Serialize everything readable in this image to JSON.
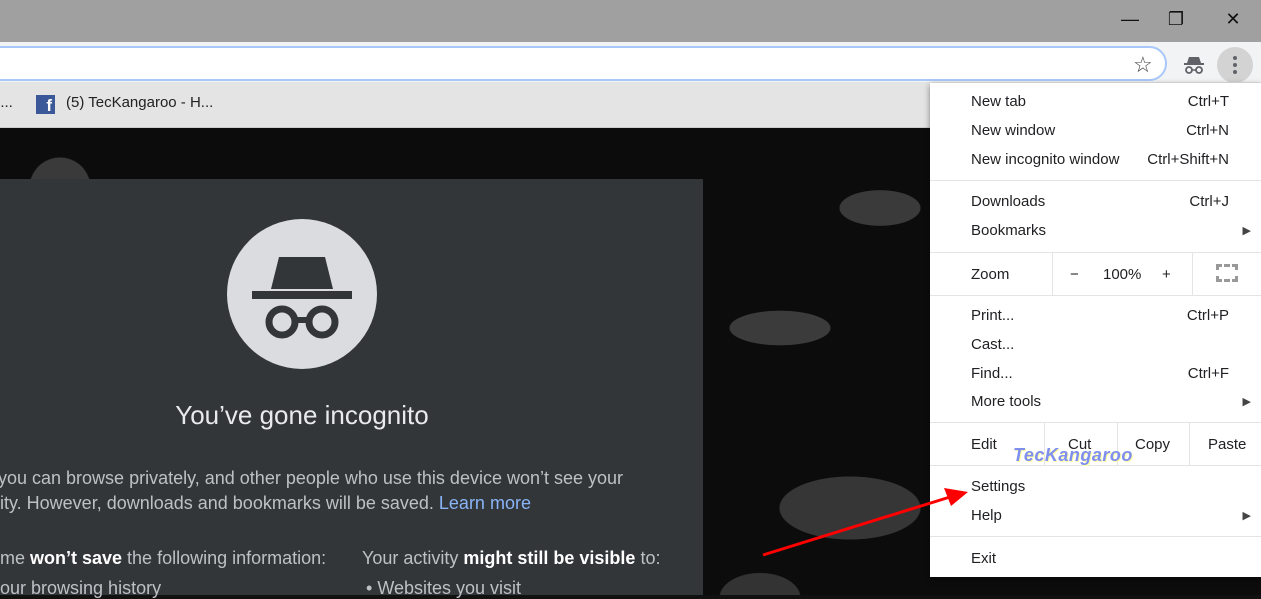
{
  "window": {
    "minimize": "—",
    "restore": "❐",
    "close": "✕"
  },
  "toolbar": {
    "star": "☆"
  },
  "bookmarks": [
    {
      "label": "o..."
    },
    {
      "label": "(5) TecKangaroo - H..."
    }
  ],
  "incognito": {
    "title": "You’ve gone incognito",
    "line1": "you can browse privately, and other people who use this device won’t see your",
    "line2": "ity. However, downloads and bookmarks will be saved.",
    "learn_more": "Learn more",
    "left_head_pre": "me ",
    "left_head_bold": "won’t save",
    "left_head_post": " the following information:",
    "right_head_pre": "Your activity ",
    "right_head_bold": "might still be visible",
    "right_head_post": " to:",
    "left_item": "our browsing history",
    "right_item": "Websites you visit"
  },
  "menu": {
    "new_tab": "New tab",
    "new_tab_sc": "Ctrl+T",
    "new_window": "New window",
    "new_window_sc": "Ctrl+N",
    "new_incognito": "New incognito window",
    "new_incognito_sc": "Ctrl+Shift+N",
    "downloads": "Downloads",
    "downloads_sc": "Ctrl+J",
    "bookmarks": "Bookmarks",
    "zoom": "Zoom",
    "zoom_minus": "−",
    "zoom_value": "100%",
    "zoom_plus": "+",
    "print": "Print...",
    "print_sc": "Ctrl+P",
    "cast": "Cast...",
    "find": "Find...",
    "find_sc": "Ctrl+F",
    "more_tools": "More tools",
    "edit": "Edit",
    "cut": "Cut",
    "copy": "Copy",
    "paste": "Paste",
    "settings": "Settings",
    "help": "Help",
    "exit": "Exit"
  },
  "watermark": "TecKangaroo",
  "colors": {
    "accent_link": "#8ab4f8",
    "arrow": "#ff0000"
  }
}
